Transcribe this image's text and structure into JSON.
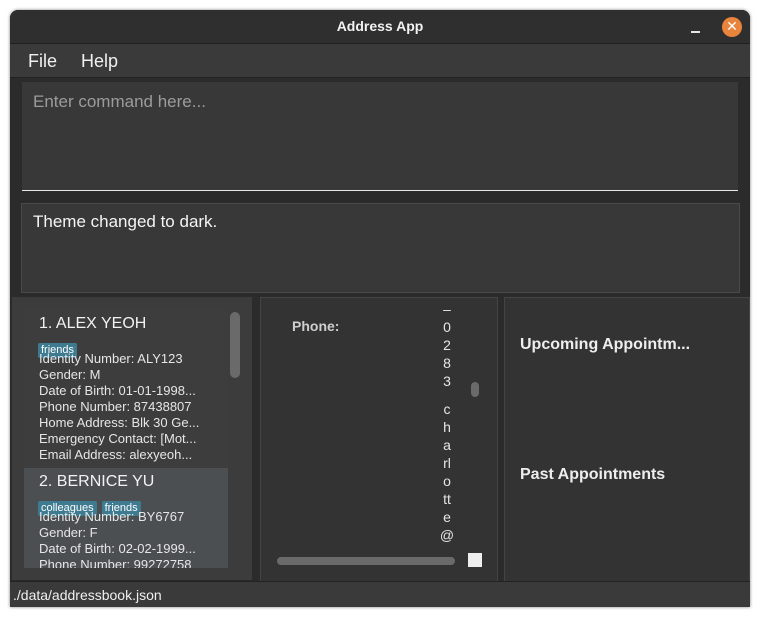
{
  "window": {
    "title": "Address App"
  },
  "menu": {
    "file": "File",
    "help": "Help"
  },
  "command": {
    "placeholder": "Enter command here..."
  },
  "result": {
    "text": "Theme changed to dark."
  },
  "persons": [
    {
      "name": "1.  ALEX YEOH",
      "tags": [
        "friends"
      ],
      "identity": "Identity Number: ALY123",
      "gender": "Gender: M",
      "dob": "Date of Birth: 01-01-1998...",
      "phone": "Phone Number: 87438807",
      "address": "Home Address: Blk 30 Ge...",
      "emergency": "Emergency Contact: [Mot...",
      "email": "Email Address: alexyeoh..."
    },
    {
      "name": "2.  BERNICE YU",
      "tags": [
        "colleagues",
        "friends"
      ],
      "identity": "Identity Number: BY6767",
      "gender": "Gender: F",
      "dob": "Date of Birth: 02-02-1999...",
      "phone": "Phone Number: 99272758"
    }
  ],
  "detail": {
    "phone_label": "Phone:",
    "chars_top": [
      "–",
      "0",
      "2",
      "8",
      "3"
    ],
    "chars_bottom": [
      "c",
      "h",
      "a",
      "rl",
      "o",
      "tt",
      "e",
      "@"
    ]
  },
  "appointments": {
    "upcoming": "Upcoming Appointm...",
    "past": "Past Appointments"
  },
  "status": {
    "path": "./data/addressbook.json"
  },
  "colors": {
    "accent_close": "#e9843d",
    "tag": "#3e7b91",
    "background": "#2b2b2b"
  }
}
